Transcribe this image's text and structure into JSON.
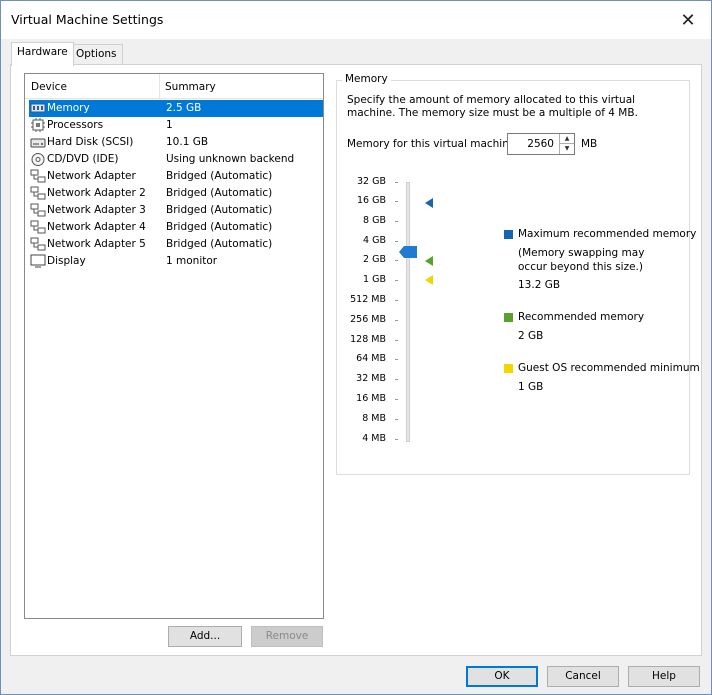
{
  "window": {
    "title": "Virtual Machine Settings"
  },
  "tabs": [
    {
      "label": "Hardware"
    },
    {
      "label": "Options"
    }
  ],
  "device_list": {
    "headers": {
      "device": "Device",
      "summary": "Summary"
    },
    "rows": [
      {
        "name": "Memory",
        "summary": "2.5 GB",
        "icon": "memory-icon"
      },
      {
        "name": "Processors",
        "summary": "1",
        "icon": "processor-icon"
      },
      {
        "name": "Hard Disk (SCSI)",
        "summary": "10.1 GB",
        "icon": "hard-disk-icon"
      },
      {
        "name": "CD/DVD (IDE)",
        "summary": "Using unknown backend",
        "icon": "cd-dvd-icon"
      },
      {
        "name": "Network Adapter",
        "summary": "Bridged (Automatic)",
        "icon": "network-adapter-icon"
      },
      {
        "name": "Network Adapter 2",
        "summary": "Bridged (Automatic)",
        "icon": "network-adapter-icon"
      },
      {
        "name": "Network Adapter 3",
        "summary": "Bridged (Automatic)",
        "icon": "network-adapter-icon"
      },
      {
        "name": "Network Adapter 4",
        "summary": "Bridged (Automatic)",
        "icon": "network-adapter-icon"
      },
      {
        "name": "Network Adapter 5",
        "summary": "Bridged (Automatic)",
        "icon": "network-adapter-icon"
      },
      {
        "name": "Display",
        "summary": "1 monitor",
        "icon": "display-icon"
      }
    ]
  },
  "buttons": {
    "add": "Add...",
    "remove": "Remove",
    "ok": "OK",
    "cancel": "Cancel",
    "help": "Help"
  },
  "memory": {
    "group_title": "Memory",
    "description": "Specify the amount of memory allocated to this virtual machine. The memory size must be a multiple of 4 MB.",
    "field_label": "Memory for this virtual machine:",
    "value": "2560",
    "unit": "MB",
    "scale": [
      "32 GB",
      "16 GB",
      "8 GB",
      "4 GB",
      "2 GB",
      "1 GB",
      "512 MB",
      "256 MB",
      "128 MB",
      "64 MB",
      "32 MB",
      "16 MB",
      "8 MB",
      "4 MB"
    ],
    "legend": {
      "max_title": "Maximum recommended memory",
      "max_note": "(Memory swapping may\noccur beyond this size.)",
      "max_value": "13.2 GB",
      "rec_title": "Recommended memory",
      "rec_value": "2 GB",
      "min_title": "Guest OS recommended minimum",
      "min_value": "1 GB"
    }
  },
  "colors": {
    "selection": "#0078d7",
    "max_marker": "#1565b0",
    "recommended_marker": "#5aa02c",
    "minimum_marker": "#f2d600",
    "slider_thumb": "#1f7ad2"
  }
}
